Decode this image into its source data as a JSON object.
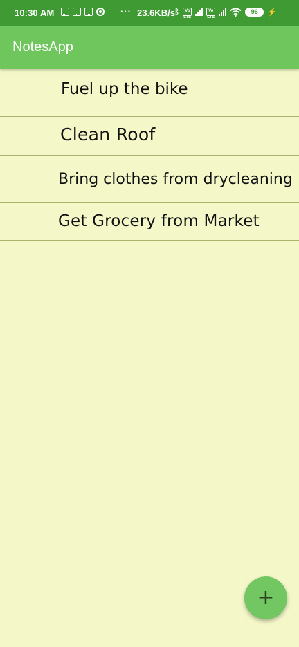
{
  "status_bar": {
    "time": "10:30 AM",
    "dots": "···",
    "network_speed": "23.6KB/s",
    "volte_1": "Vo LTE",
    "volte_2": "Vo LTE",
    "battery": "96",
    "icons": [
      "grid-notification-icon",
      "grid-notification-icon",
      "grid-notification-icon",
      "circle-notification-icon",
      "bluetooth-icon",
      "volte-icon",
      "signal-icon",
      "volte-icon",
      "signal-icon",
      "wifi-icon",
      "battery-icon",
      "charging-icon"
    ]
  },
  "app_bar": {
    "title": "NotesApp"
  },
  "notes": [
    {
      "text": "Fuel up the bike"
    },
    {
      "text": "Clean Roof"
    },
    {
      "text": "Bring clothes from drycleaning"
    },
    {
      "text": "Get Grocery from Market"
    }
  ],
  "fab": {
    "icon": "+",
    "icon_name": "plus-icon"
  },
  "colors": {
    "status_bar": "#3f9a34",
    "app_bar": "#6ec65d",
    "background": "#f4f7c8",
    "divider": "#aab26b",
    "fab": "#72c762"
  }
}
